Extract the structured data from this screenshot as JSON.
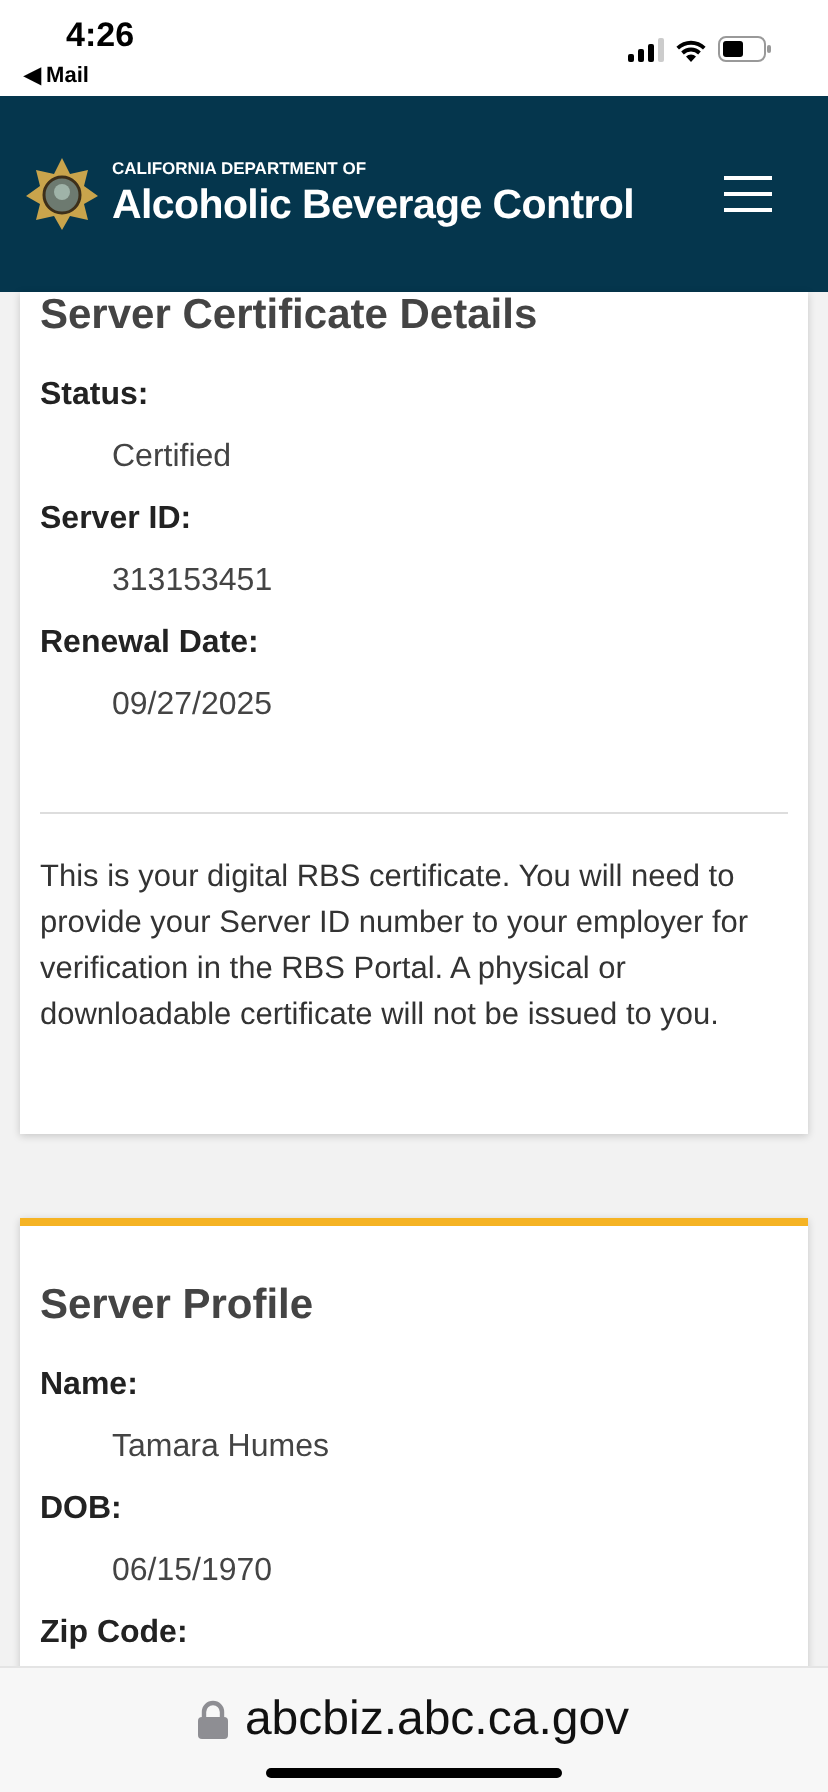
{
  "status_bar": {
    "time": "4:26",
    "back_label": "◀ Mail"
  },
  "header": {
    "subtitle": "CALIFORNIA DEPARTMENT OF",
    "title": "Alcoholic Beverage Control"
  },
  "cards": [
    {
      "title": "Server Certificate Details",
      "accent": false,
      "fields": [
        {
          "label": "Status:",
          "value": "Certified"
        },
        {
          "label": "Server ID:",
          "value": "313153451"
        },
        {
          "label": "Renewal Date:",
          "value": "09/27/2025"
        }
      ],
      "note": "This is your digital RBS certificate. You will need to provide your Server ID number to your employer for verification in the RBS Portal. A physical or downloadable certificate will not be issued to you."
    },
    {
      "title": "Server Profile",
      "accent": true,
      "fields": [
        {
          "label": "Name:",
          "value": "Tamara Humes"
        },
        {
          "label": "DOB:",
          "value": "06/15/1970"
        },
        {
          "label": "Zip Code:"
        }
      ]
    }
  ],
  "address_bar": {
    "url": "abcbiz.abc.ca.gov"
  }
}
